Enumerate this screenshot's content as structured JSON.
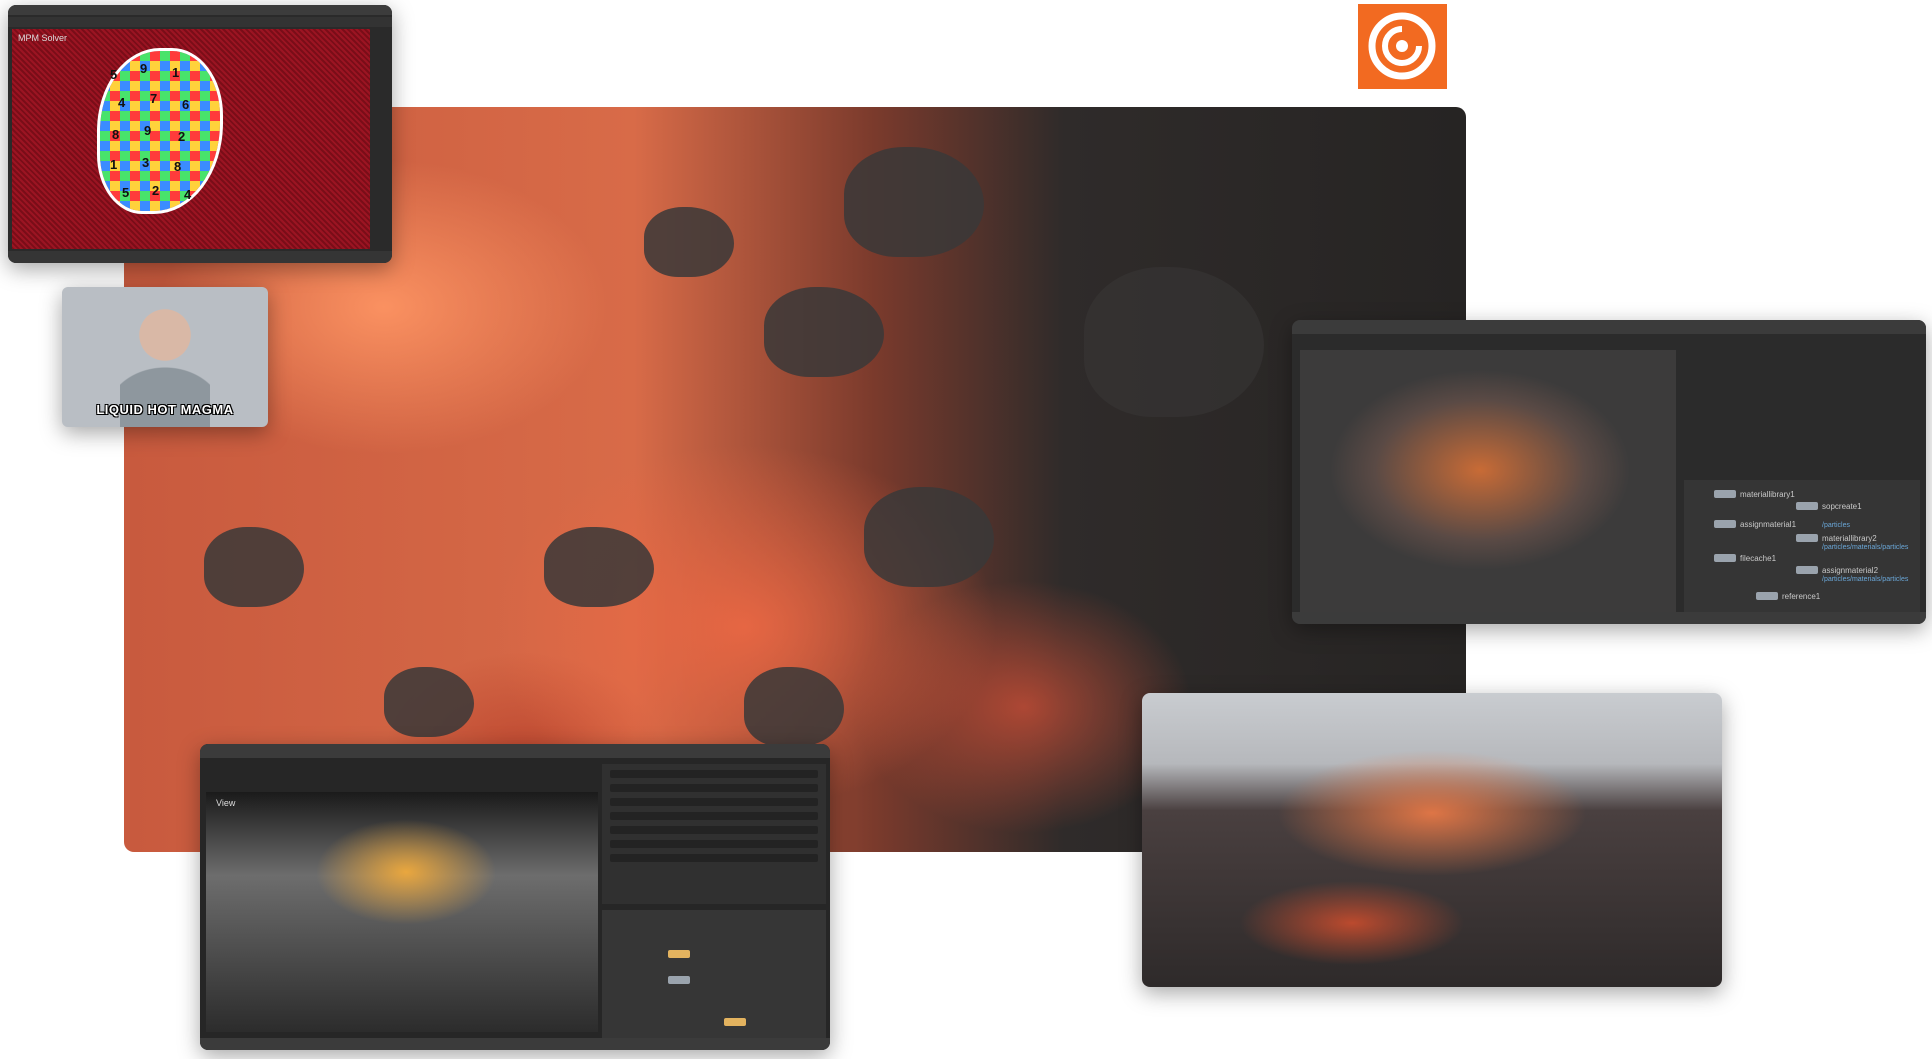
{
  "top_window": {
    "viewport_label": "MPM Solver",
    "uv_numbers": [
      "5",
      "9",
      "1",
      "4",
      "7",
      "6",
      "8",
      "9",
      "2",
      "1",
      "3",
      "8",
      "5",
      "2",
      "4"
    ]
  },
  "meme": {
    "caption": "LIQUID HOT MAGMA"
  },
  "right_window": {
    "nodes": [
      {
        "name": "materiallibrary1",
        "sub": ""
      },
      {
        "name": "sopcreate1",
        "sub": "/particles"
      },
      {
        "name": "assignmaterial1",
        "sub": ""
      },
      {
        "name": "materiallibrary2",
        "sub": "/particles/materials/particles"
      },
      {
        "name": "filecache1",
        "sub": ""
      },
      {
        "name": "assignmaterial2",
        "sub": "/particles/materials/particles"
      },
      {
        "name": "reference1",
        "sub": ""
      }
    ]
  },
  "bottom_window": {
    "viewport_label": "View"
  },
  "colors": {
    "houdini_orange": "#f26a21",
    "lava": "#d86b48",
    "basalt": "#2f2b2a"
  }
}
